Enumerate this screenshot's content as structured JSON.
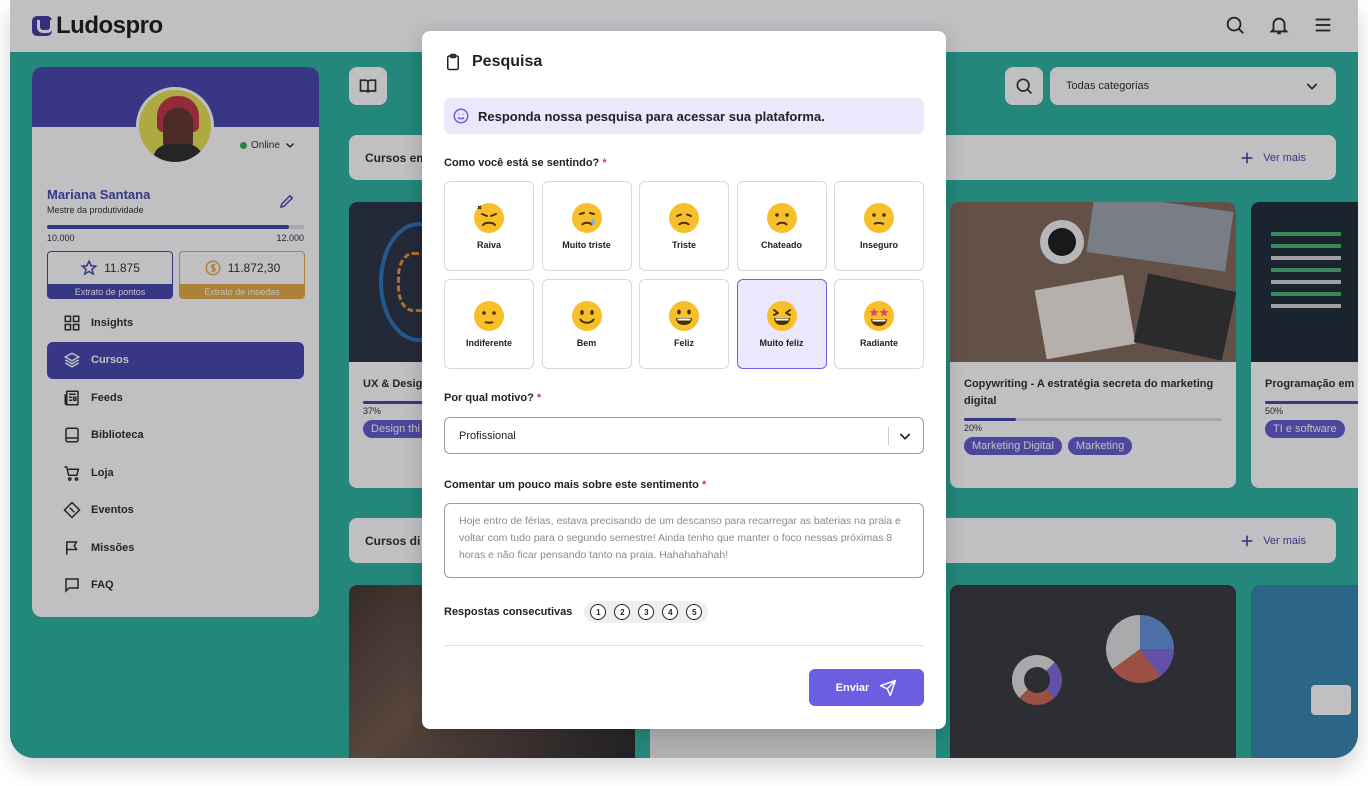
{
  "app": {
    "brand": "Ludospro"
  },
  "profile": {
    "status": "Online",
    "name": "Mariana Santana",
    "role": "Mestre da produtividade",
    "xp_min": "10.000",
    "xp_max": "12.000",
    "xp_progress": 0.94,
    "points_value": "11.875",
    "points_label": "Extrato de pontos",
    "coins_value": "11.872,30",
    "coins_label": "Extrato de moedas"
  },
  "menu": [
    {
      "label": "Insights",
      "icon": "grid-icon"
    },
    {
      "label": "Cursos",
      "icon": "layers-icon",
      "active": true
    },
    {
      "label": "Feeds",
      "icon": "newspaper-icon"
    },
    {
      "label": "Biblioteca",
      "icon": "book-icon"
    },
    {
      "label": "Loja",
      "icon": "cart-icon"
    },
    {
      "label": "Eventos",
      "icon": "ticket-icon"
    },
    {
      "label": "Missões",
      "icon": "flag-icon"
    },
    {
      "label": "FAQ",
      "icon": "chat-icon"
    }
  ],
  "main": {
    "category_select": "Todas categorias",
    "section1_title": "Cursos em",
    "section2_title": "Cursos di",
    "see_more": "Ver mais",
    "cards": [
      {
        "title": "UX & Design Thinking nos negócios",
        "title_visible": "UX & Desig nos negócio",
        "progress": 37,
        "progress_text": "37%",
        "tags": [
          "Design thi"
        ]
      },
      {
        "title": "Copywriting - A estratégia secreta do marketing digital",
        "progress": 20,
        "progress_text": "20%",
        "tags": [
          "Marketing Digital",
          "Marketing"
        ]
      },
      {
        "title": "Programação em l",
        "progress": 50,
        "progress_text": "50%",
        "tags": [
          "TI e software"
        ]
      }
    ]
  },
  "modal": {
    "title": "Pesquisa",
    "banner": "Responda nossa pesquisa para acessar sua plataforma.",
    "q1": "Como você está se sentindo?",
    "required_mark": "*",
    "emotions": [
      "Raiva",
      "Muito triste",
      "Triste",
      "Chateado",
      "Inseguro",
      "Indiferente",
      "Bem",
      "Feliz",
      "Muito feliz",
      "Radiante"
    ],
    "selected_emotion": "Muito feliz",
    "q2": "Por qual motivo?",
    "reason": "Profissional",
    "q3": "Comentar um pouco mais sobre este sentimento",
    "comment": "Hoje entro de férias, estava precisando de um descanso para recarregar as baterias na praia e voltar com tudo para o segundo semestre! Ainda tenho que manter o foco nessas próximas 8 horas e não ficar pensando tanto na praia. Hahahahahah!",
    "streak_label": "Respostas consecutivas",
    "streak": [
      "1",
      "2",
      "3",
      "4",
      "5"
    ],
    "send": "Enviar"
  },
  "colors": {
    "accent": "#3c3ca8",
    "teal": "#20ae98",
    "purple": "#6b5ee0",
    "gold": "#e3a63a",
    "emoji": "#f7c02b"
  }
}
